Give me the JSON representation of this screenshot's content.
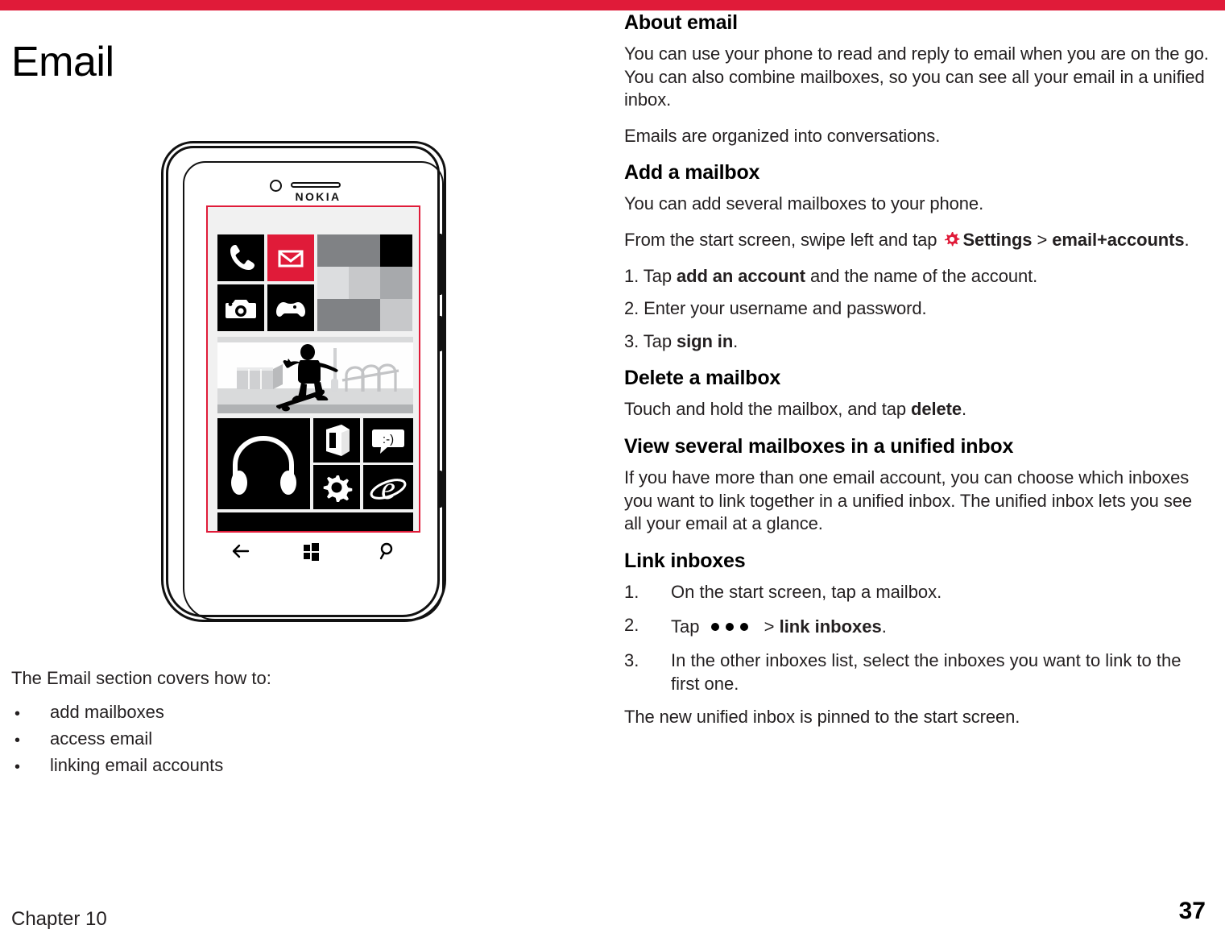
{
  "theme": {
    "accent_red": "#e01b39",
    "text": "#231f20"
  },
  "topbar": {
    "name": "red-rule"
  },
  "left": {
    "page_title": "Email",
    "covers_intro": "The Email section covers how to:",
    "bullets": [
      "add mailboxes",
      "access email",
      "linking email accounts"
    ],
    "footer_chapter": "Chapter 10",
    "footer_page": "37"
  },
  "phone": {
    "brand": "NOKIA",
    "tiles": [
      {
        "name": "phone-tile",
        "icon": "phone-icon",
        "color": "#000000"
      },
      {
        "name": "mail-tile",
        "icon": "envelope-icon",
        "color": "#e01b39"
      },
      {
        "name": "camera-tile",
        "icon": "camera-icon",
        "color": "#000000"
      },
      {
        "name": "games-tile",
        "icon": "gamepad-icon",
        "color": "#000000"
      },
      {
        "name": "people-tile",
        "icon": "photo-mosaic",
        "color": "#808285"
      },
      {
        "name": "photo-tile",
        "icon": "skateboarder-photo",
        "color": "#d9dadb"
      },
      {
        "name": "music-tile",
        "icon": "headphones-icon",
        "color": "#000000"
      },
      {
        "name": "office-tile",
        "icon": "office-icon",
        "color": "#000000"
      },
      {
        "name": "messaging-tile",
        "icon": "smiley-chat-icon",
        "color": "#000000"
      },
      {
        "name": "settings-tile",
        "icon": "gear-icon",
        "color": "#000000"
      },
      {
        "name": "browser-tile",
        "icon": "internet-explorer-icon",
        "color": "#000000"
      }
    ],
    "nav": [
      {
        "name": "back-button",
        "icon": "back-arrow-icon"
      },
      {
        "name": "start-button",
        "icon": "windows-logo-icon"
      },
      {
        "name": "search-button",
        "icon": "search-icon"
      }
    ]
  },
  "right": {
    "sections": [
      {
        "heading": "About email",
        "paragraphs": [
          "You can use your phone to read and reply to email when you are on the go. You can also combine mailboxes, so you can see all your email in a unified inbox.",
          "Emails are organized into conversations."
        ]
      },
      {
        "heading": "Add a mailbox",
        "intro": "You can add several mailboxes to your phone.",
        "swipe_pre": "From the start screen, swipe left and tap",
        "swipe_settings": "Settings",
        "swipe_gt": ">",
        "swipe_target": "email+accounts",
        "swipe_period": ".",
        "steps": [
          {
            "num": "1.",
            "pre": "Tap ",
            "bold": "add an account",
            "post": " and the name of the account."
          },
          {
            "num": "2.",
            "pre": "Enter your username and password.",
            "bold": "",
            "post": ""
          },
          {
            "num": "3.",
            "pre": "Tap ",
            "bold": "sign in",
            "post": "."
          }
        ]
      },
      {
        "heading": "Delete a mailbox",
        "line_pre": "Touch and hold the mailbox, and tap ",
        "line_bold": "delete",
        "line_post": "."
      },
      {
        "heading": "View several mailboxes in a unified inbox",
        "paragraph": "If you have more than one email account, you can choose which inboxes you want to link together in a unified inbox. The unified inbox lets you see all your email at a glance."
      },
      {
        "heading": "Link inboxes",
        "steps": [
          {
            "num": "1.",
            "text": "On the start screen, tap a mailbox."
          },
          {
            "num": "2.",
            "pre": "Tap",
            "icon": "more-dots-icon",
            "gt": "> ",
            "bold": "link inboxes",
            "post": "."
          },
          {
            "num": "3.",
            "text": "In the other inboxes list, select the inboxes you want to link to the first one."
          }
        ],
        "closing": "The new unified inbox is pinned to the start screen."
      }
    ]
  }
}
